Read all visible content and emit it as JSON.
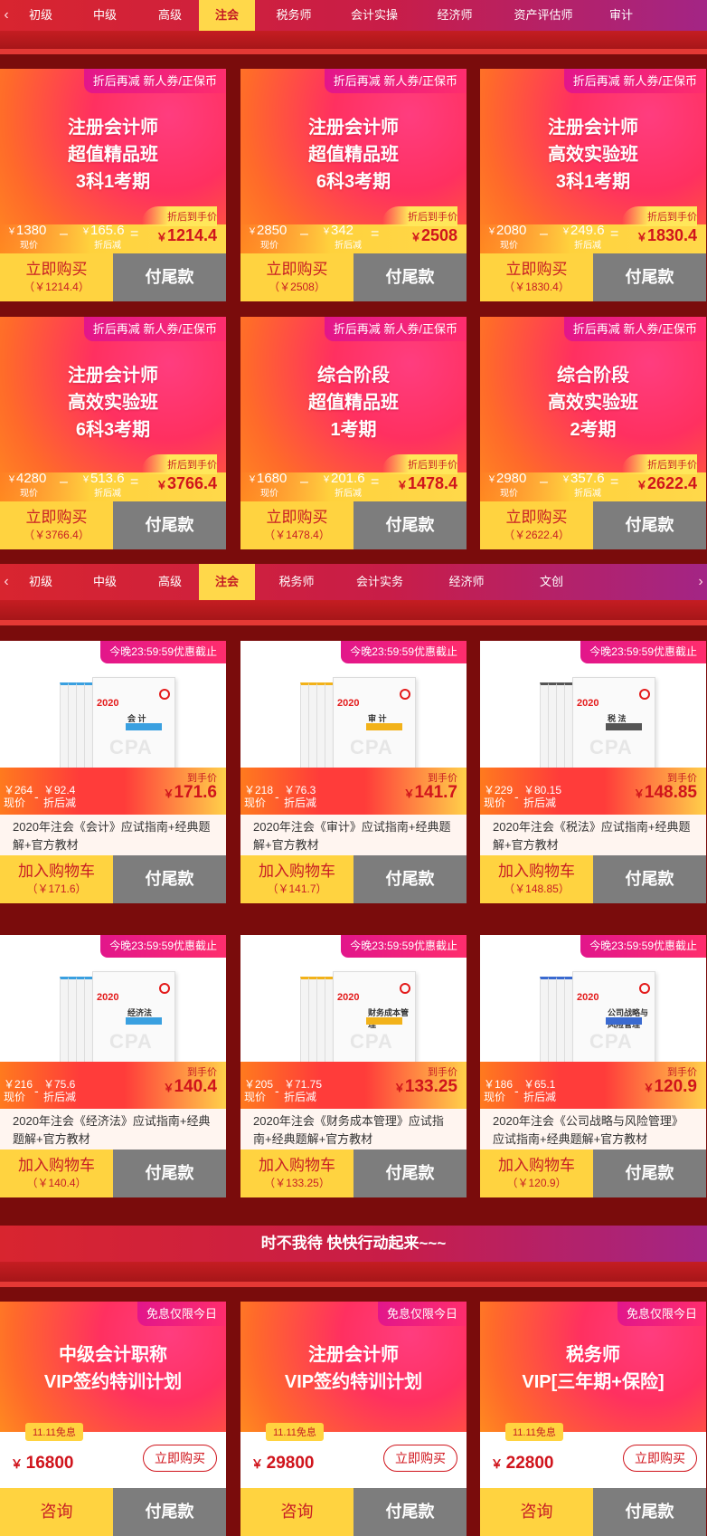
{
  "nav1": {
    "tabs": [
      "初级",
      "中级",
      "高级",
      "注会",
      "税务师",
      "会计实操",
      "经济师",
      "资产评估师",
      "审计"
    ],
    "active": "注会"
  },
  "nav2": {
    "tabs": [
      "初级",
      "中级",
      "高级",
      "注会",
      "税务师",
      "会计实务",
      "经济师",
      "文创"
    ],
    "active": "注会"
  },
  "classes": [
    {
      "promo": "折后再减 新人券/正保币",
      "title1": "注册会计师",
      "title2": "超值精品班",
      "title3": "3科1考期",
      "orig": "1380",
      "orig_label": "现价",
      "off": "165.6",
      "off_label": "折后减",
      "final_label": "折后到手价",
      "final": "1214.4",
      "buy": "立即购买",
      "buy_sub": "（￥1214.4）",
      "tail": "付尾款"
    },
    {
      "promo": "折后再减 新人券/正保币",
      "title1": "注册会计师",
      "title2": "超值精品班",
      "title3": "6科3考期",
      "orig": "2850",
      "orig_label": "现价",
      "off": "342",
      "off_label": "折后减",
      "final_label": "折后到手价",
      "final": "2508",
      "buy": "立即购买",
      "buy_sub": "（￥2508）",
      "tail": "付尾款"
    },
    {
      "promo": "折后再减 新人券/正保币",
      "title1": "注册会计师",
      "title2": "高效实验班",
      "title3": "3科1考期",
      "orig": "2080",
      "orig_label": "现价",
      "off": "249.6",
      "off_label": "折后减",
      "final_label": "折后到手价",
      "final": "1830.4",
      "buy": "立即购买",
      "buy_sub": "（￥1830.4）",
      "tail": "付尾款"
    },
    {
      "promo": "折后再减 新人券/正保币",
      "title1": "注册会计师",
      "title2": "高效实验班",
      "title3": "6科3考期",
      "orig": "4280",
      "orig_label": "现价",
      "off": "513.6",
      "off_label": "折后减",
      "final_label": "折后到手价",
      "final": "3766.4",
      "buy": "立即购买",
      "buy_sub": "（￥3766.4）",
      "tail": "付尾款"
    },
    {
      "promo": "折后再减 新人券/正保币",
      "title1": "综合阶段",
      "title2": "超值精品班",
      "title3": "1考期",
      "orig": "1680",
      "orig_label": "现价",
      "off": "201.6",
      "off_label": "折后减",
      "final_label": "折后到手价",
      "final": "1478.4",
      "buy": "立即购买",
      "buy_sub": "（￥1478.4）",
      "tail": "付尾款"
    },
    {
      "promo": "折后再减 新人券/正保币",
      "title1": "综合阶段",
      "title2": "高效实验班",
      "title3": "2考期",
      "orig": "2980",
      "orig_label": "现价",
      "off": "357.6",
      "off_label": "折后减",
      "final_label": "折后到手价",
      "final": "2622.4",
      "buy": "立即购买",
      "buy_sub": "（￥2622.4）",
      "tail": "付尾款"
    }
  ],
  "books": [
    {
      "deadline": "今晚23:59:59优惠截止",
      "cover_year": "2020",
      "cover_title": "会 计",
      "orig": "264",
      "orig_label": "现价",
      "off": "92.4",
      "off_label": "折后减",
      "final_label": "到手价",
      "final": "171.6",
      "desc": "2020年注会《会计》应试指南+经典题解+官方教材",
      "buy": "加入购物车",
      "buy_sub": "（￥171.6）",
      "tail": "付尾款",
      "bar_color": "#3aa0e0"
    },
    {
      "deadline": "今晚23:59:59优惠截止",
      "cover_year": "2020",
      "cover_title": "审 计",
      "orig": "218",
      "orig_label": "现价",
      "off": "76.3",
      "off_label": "折后减",
      "final_label": "到手价",
      "final": "141.7",
      "desc": "2020年注会《审计》应试指南+经典题解+官方教材",
      "buy": "加入购物车",
      "buy_sub": "（￥141.7）",
      "tail": "付尾款",
      "bar_color": "#f2b21a"
    },
    {
      "deadline": "今晚23:59:59优惠截止",
      "cover_year": "2020",
      "cover_title": "税 法",
      "orig": "229",
      "orig_label": "现价",
      "off": "80.15",
      "off_label": "折后减",
      "final_label": "到手价",
      "final": "148.85",
      "desc": "2020年注会《税法》应试指南+经典题解+官方教材",
      "buy": "加入购物车",
      "buy_sub": "（￥148.85）",
      "tail": "付尾款",
      "bar_color": "#555555"
    },
    {
      "deadline": "今晚23:59:59优惠截止",
      "cover_year": "2020",
      "cover_title": "经济法",
      "orig": "216",
      "orig_label": "现价",
      "off": "75.6",
      "off_label": "折后减",
      "final_label": "到手价",
      "final": "140.4",
      "desc": "2020年注会《经济法》应试指南+经典题解+官方教材",
      "buy": "加入购物车",
      "buy_sub": "（￥140.4）",
      "tail": "付尾款",
      "bar_color": "#3aa0e0"
    },
    {
      "deadline": "今晚23:59:59优惠截止",
      "cover_year": "2020",
      "cover_title": "财务成本管理",
      "orig": "205",
      "orig_label": "现价",
      "off": "71.75",
      "off_label": "折后减",
      "final_label": "到手价",
      "final": "133.25",
      "desc": "2020年注会《财务成本管理》应试指南+经典题解+官方教材",
      "buy": "加入购物车",
      "buy_sub": "（￥133.25）",
      "tail": "付尾款",
      "bar_color": "#f2b21a"
    },
    {
      "deadline": "今晚23:59:59优惠截止",
      "cover_year": "2020",
      "cover_title": "公司战略与风险管理",
      "orig": "186",
      "orig_label": "现价",
      "off": "65.1",
      "off_label": "折后减",
      "final_label": "到手价",
      "final": "120.9",
      "desc": "2020年注会《公司战略与风险管理》应试指南+经典题解+官方教材",
      "buy": "加入购物车",
      "buy_sub": "（￥120.9）",
      "tail": "付尾款",
      "bar_color": "#3a6ad0"
    }
  ],
  "banner": "时不我待 快快行动起来~~~",
  "vip": [
    {
      "promo": "免息仅限今日",
      "title1": "中级会计职称",
      "title2": "VIP签约特训计划",
      "free": "11.11免息",
      "price": "16800",
      "buy": "立即购买",
      "consult": "咨询",
      "tail": "付尾款"
    },
    {
      "promo": "免息仅限今日",
      "title1": "注册会计师",
      "title2": "VIP签约特训计划",
      "free": "11.11免息",
      "price": "29800",
      "buy": "立即购买",
      "consult": "咨询",
      "tail": "付尾款"
    },
    {
      "promo": "免息仅限今日",
      "title1": "税务师",
      "title2": "VIP[三年期+保险]",
      "free": "11.11免息",
      "price": "22800",
      "buy": "立即购买",
      "consult": "咨询",
      "tail": "付尾款"
    }
  ],
  "currency": "￥",
  "colors": {
    "accent": "#ffd340",
    "brand_red": "#d0141c",
    "tail_gray": "#7d7d7d",
    "page_bg": "#7a0c0c"
  }
}
